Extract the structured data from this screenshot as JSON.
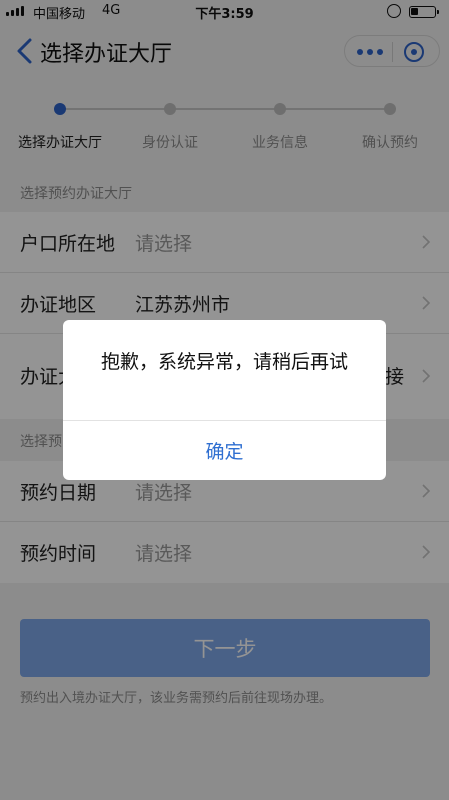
{
  "status_bar": {
    "carrier": "中国移动",
    "network": "4G",
    "time": "下午3:59"
  },
  "nav": {
    "title": "选择办证大厅"
  },
  "steps": [
    {
      "label": "选择办证大厅",
      "active": true
    },
    {
      "label": "身份认证",
      "active": false
    },
    {
      "label": "业务信息",
      "active": false
    },
    {
      "label": "确认预约",
      "active": false
    }
  ],
  "section1": {
    "heading": "选择预约办证大厅",
    "rows": [
      {
        "label": "户口所在地",
        "value": "请选择",
        "placeholder": true
      },
      {
        "label": "办证地区",
        "value": "江苏苏州市",
        "placeholder": false
      },
      {
        "label": "办证大",
        "value": "接",
        "placeholder": false
      }
    ]
  },
  "section2": {
    "heading": "选择预",
    "rows": [
      {
        "label": "预约日期",
        "value": "请选择",
        "placeholder": true
      },
      {
        "label": "预约时间",
        "value": "请选择",
        "placeholder": true
      }
    ]
  },
  "next_button": "下一步",
  "footnote": "预约出入境办证大厅，该业务需预约后前往现场办理。",
  "dialog": {
    "message": "抱歉，系统异常，请稍后再试",
    "confirm": "确定"
  },
  "colors": {
    "accent": "#2e62c8",
    "button_disabled": "#7ea7e8",
    "dialog_link": "#2f6fd1"
  }
}
